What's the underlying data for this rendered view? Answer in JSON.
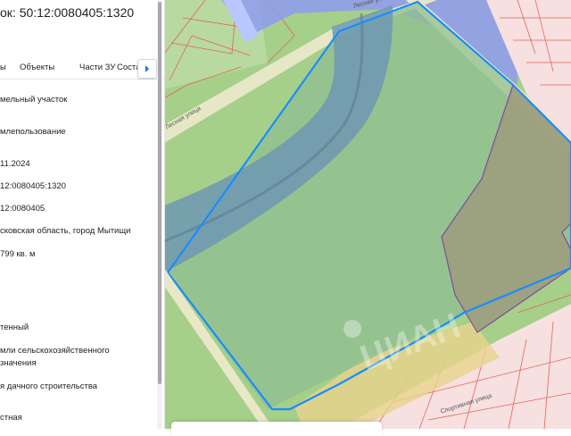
{
  "panel": {
    "title": "ок: 50:12:0080405:1320",
    "tabs": [
      {
        "label": "ы"
      },
      {
        "label": "Объекты"
      },
      {
        "label": "Части ЗУ"
      },
      {
        "label": "Соста"
      }
    ],
    "tabs_next_icon": "chevron-right-icon",
    "rows": [
      {
        "value": "мельный участок"
      },
      {
        "value": "млепользование"
      },
      {
        "value": "11.2024"
      },
      {
        "value": "12:0080405:1320"
      },
      {
        "value": "12:0080405"
      },
      {
        "value": "сковская область, город Мытищи"
      },
      {
        "value": "799 кв. м"
      },
      {
        "value": "тенный"
      },
      {
        "value": "мли сельскохозяйственного"
      },
      {
        "value": "значения"
      },
      {
        "value": "я дачного строительства"
      },
      {
        "value": "стная"
      }
    ]
  },
  "map": {
    "streets": [
      "Лесная улица",
      "Лесная улица",
      "Спортивная улица"
    ],
    "watermark": "ЦИАН",
    "colors": {
      "selected_parcel_outline": "#1a8cff",
      "parcel_outline": "#e0665b",
      "zone_outline": "#7b3fa0",
      "overlay_blue": "#8f9bf0",
      "water": "#6f98b3",
      "greenery": "#a6cf8a",
      "residential": "#f6e0e0"
    }
  }
}
